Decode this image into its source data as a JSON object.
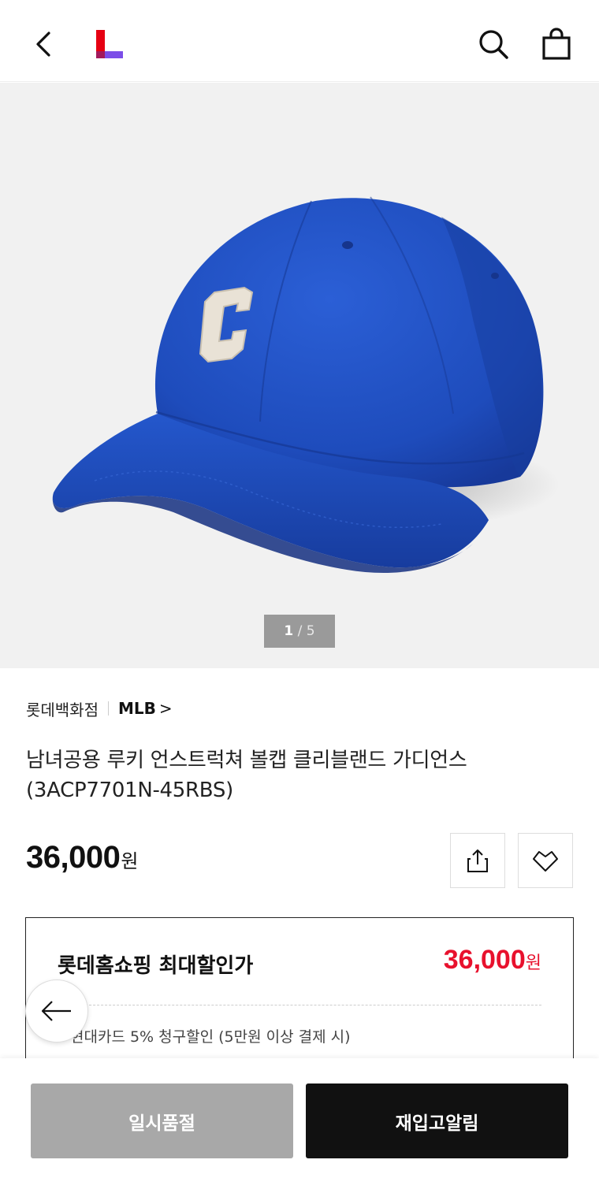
{
  "header": {
    "back_icon": "chevron-left-icon",
    "logo": "lotte-L-logo",
    "search_icon": "search-icon",
    "cart_icon": "shopping-bag-icon"
  },
  "gallery": {
    "current": "1",
    "separator": "/",
    "total": "5"
  },
  "product": {
    "store": "롯데백화점",
    "brand": "MLB",
    "brand_chevron": ">",
    "title": "남녀공용 루키 언스트럭쳐 볼캡 클리블랜드 가디언스 (3ACP7701N-45RBS)",
    "price": "36,000",
    "price_unit": "원"
  },
  "actions": {
    "share_icon": "share-icon",
    "wish_icon": "heart-icon"
  },
  "max_discount": {
    "label": "롯데홈쇼핑 최대할인가",
    "price": "36,000",
    "price_unit": "원",
    "card_benefit": "현대카드 5% 청구할인 (5만원 이상 결제 시)"
  },
  "floating": {
    "back_icon": "arrow-left-icon"
  },
  "bottom_bar": {
    "soldout_label": "일시품절",
    "restock_label": "재입고알림"
  },
  "colors": {
    "accent_red": "#e8112d",
    "logo_red": "#e60012",
    "logo_purple": "#7b4de8",
    "cap_blue": "#1e4fbf"
  }
}
